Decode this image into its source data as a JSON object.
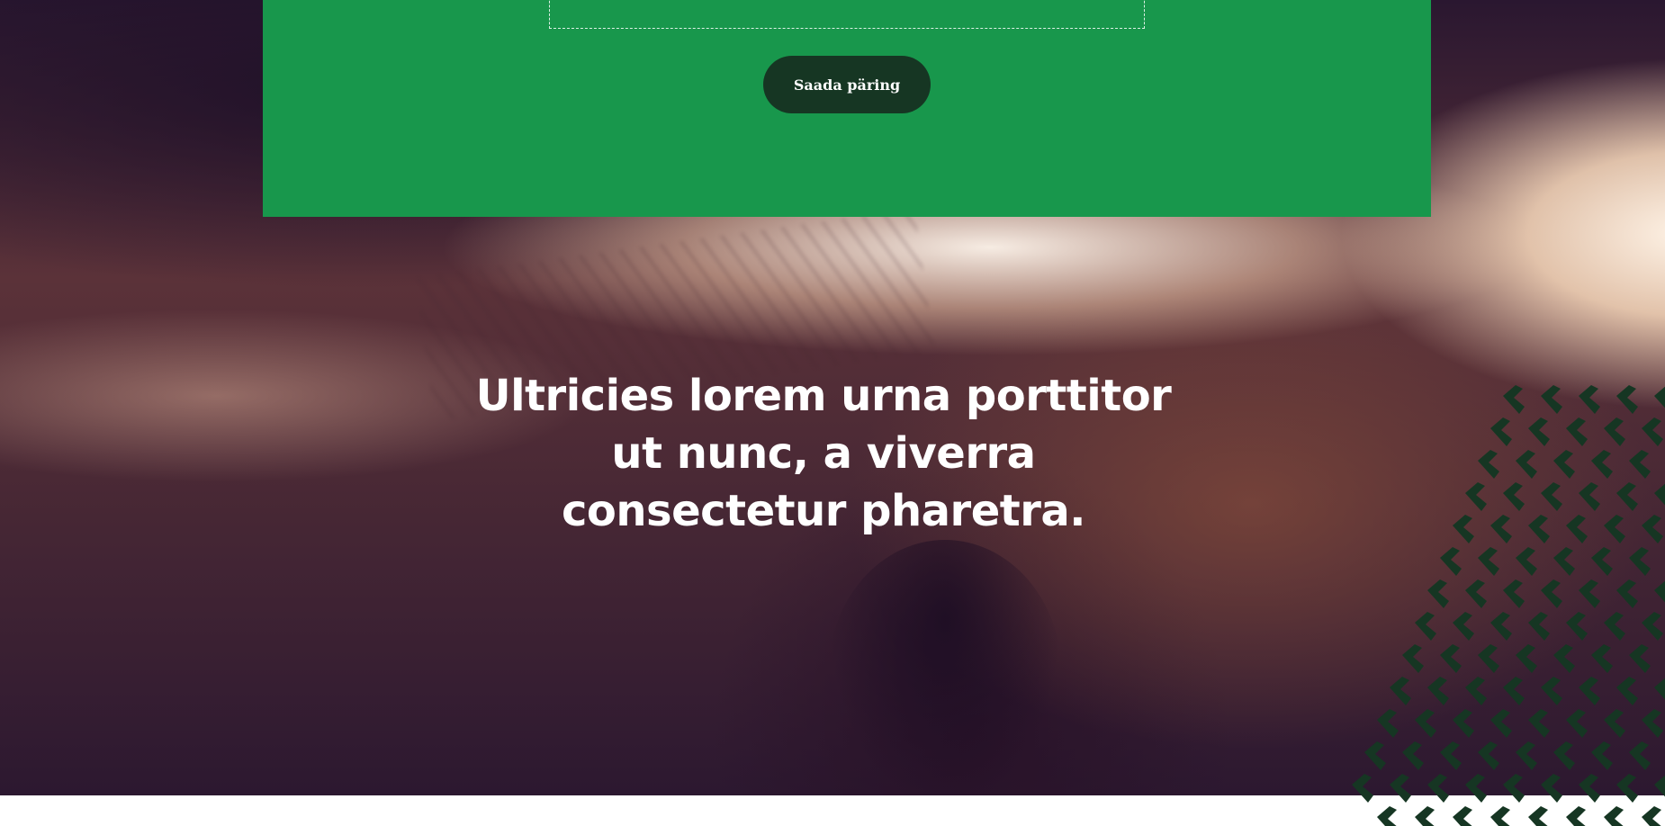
{
  "contact_form": {
    "submit_label": "Saada päring"
  },
  "hero": {
    "headline": "Ultricies lorem urna porttitor ut nunc, a viverra consectetur pharetra."
  },
  "colors": {
    "green_panel": "#18974c",
    "button_dark": "#163623",
    "pattern_dark": "#163623",
    "text_light": "#ffffff"
  },
  "icons": {
    "decorative_pattern": "leaf-pattern"
  }
}
